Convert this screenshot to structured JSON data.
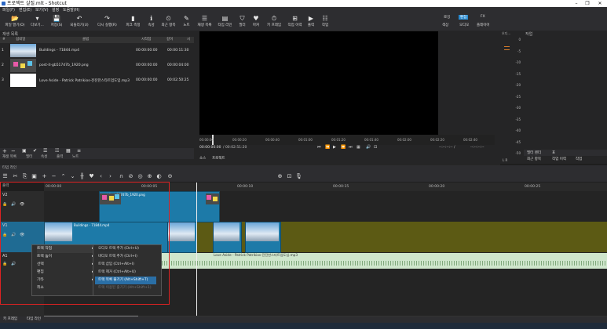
{
  "window": {
    "title": "프로젝트 살질.mlt - Shotcut"
  },
  "menus": [
    "파일(F)",
    "편집(E)",
    "보기(V)",
    "설정",
    "도움말(H)"
  ],
  "toolbar": [
    {
      "label": "파일 열기(O)",
      "icon": "folder-icon",
      "glyph": "📂"
    },
    {
      "label": "다보기...",
      "icon": "menu-icon",
      "glyph": "▾"
    },
    {
      "label": "저장(S)",
      "icon": "save-icon",
      "glyph": "💾"
    },
    {
      "label": "되돌리기(U)",
      "icon": "undo-icon",
      "glyph": "↶"
    },
    {
      "label": "다시 실행(R)",
      "icon": "redo-icon",
      "glyph": "↷"
    },
    {
      "label": "피크 측정",
      "icon": "peak-meter-icon",
      "glyph": "▮"
    },
    {
      "label": "속성",
      "icon": "properties-icon",
      "glyph": "ℹ"
    },
    {
      "label": "최근 항목",
      "icon": "recent-icon",
      "glyph": "⏲"
    },
    {
      "label": "노트",
      "icon": "notes-icon",
      "glyph": "✎"
    },
    {
      "label": "재생 목록",
      "icon": "playlist-icon",
      "glyph": "☰"
    },
    {
      "label": "타임 라인",
      "icon": "timeline-icon",
      "glyph": "▤"
    },
    {
      "label": "필터",
      "icon": "filter-icon",
      "glyph": "⛉"
    },
    {
      "label": "마커",
      "icon": "marker-icon",
      "glyph": "♥"
    },
    {
      "label": "키 프레임",
      "icon": "keyframe-icon",
      "glyph": "⏱"
    },
    {
      "label": "작업 이력",
      "icon": "history-icon",
      "glyph": "⊞"
    },
    {
      "label": "출력",
      "icon": "export-icon",
      "glyph": "▶"
    },
    {
      "label": "작업",
      "icon": "jobs-icon",
      "glyph": "☷"
    }
  ],
  "layout_tabs": {
    "top": [
      "로깅",
      "편집",
      "FX"
    ],
    "bottom": [
      "색상",
      "오디오",
      "플레이어"
    ],
    "active": "편집"
  },
  "playlist": {
    "title": "재생 목록",
    "columns": [
      "#",
      "섬네일",
      "클립",
      "시작점",
      "길이",
      "시"
    ],
    "rows": [
      {
        "index": "1",
        "name": "Buildings - 71844.mp4",
        "in": "00:00:00:00",
        "duration": "00:00:11:30",
        "thumb": "buildings"
      },
      {
        "index": "2",
        "name": "post-it-gb517d7b_1920.png",
        "in": "00:00:00:00",
        "duration": "00:00:04:00",
        "thumb": "postit"
      },
      {
        "index": "3",
        "name": "Love Aside - Patrick Patrikios-잔잔한스타트업도입.mp3",
        "in": "00:00:00:00",
        "duration": "00:02:50:25",
        "thumb": "white"
      }
    ],
    "bottom_tabs": [
      "재생 목록",
      "필터",
      "속성",
      "출력",
      "노트"
    ]
  },
  "player": {
    "ruler_ticks": [
      "00:00:00",
      "00:00:20",
      "00:00:40",
      "00:01:00",
      "00:01:20",
      "00:01:40",
      "00:02:00",
      "00:02:20",
      "00:02:40"
    ],
    "current_time": "00:00:00:00",
    "total_time": "/ 00:02:51:20",
    "in_out": "--:--:--:-- /",
    "out_time": "--:--:--:--",
    "tabs": [
      "소스",
      "프로젝트"
    ]
  },
  "meter": {
    "title": "오디...",
    "scale": [
      "0",
      "-5",
      "-10",
      "-15",
      "-20",
      "-25",
      "-30",
      "-35",
      "-40",
      "-45",
      "-50"
    ],
    "lr": "L R"
  },
  "right_panel": {
    "title": "작업",
    "tabs_top": [
      "필터 렌더",
      "표"
    ],
    "tabs_bottom": [
      "최근 항목",
      "작업 이력",
      "작업"
    ]
  },
  "timeline": {
    "title": "타임 라인",
    "ruler_label": "출력",
    "ticks": [
      "00:00:00",
      "00:00:05",
      "00:00:10",
      "00:00:15",
      "00:00:20",
      "00:00:25"
    ],
    "tracks": [
      {
        "name": "V2",
        "type": "video"
      },
      {
        "name": "V1",
        "type": "video"
      },
      {
        "name": "A1",
        "type": "audio"
      }
    ],
    "audio_clip_name": "Love Aside - Patrick Patrikios-잔잔한스타트업도입.mp3",
    "video_clip_name": "Buildings - 71844.mp4",
    "image_clip_name": "post-it-gb517d7b_1920.png"
  },
  "context_menu": {
    "items": [
      "트랙 작업",
      "트랙 높이",
      "선택",
      "편집",
      "기타",
      "취소"
    ],
    "submenu": [
      "오디오 트랙 추가 (Ctrl+U)",
      "비디오 트랙 추가 (Ctrl+I)",
      "트랙 삽입 (Ctrl+Alt+I)",
      "트랙 제거 (Ctrl+Alt+U)",
      "트랙 목록 줄기기 (Alt+Shift+T)",
      "트랙 이용된 줄기기 (Alt+Shift+1)"
    ]
  },
  "bottom_tabs": [
    "키 프레임",
    "타임 라인"
  ],
  "colors": {
    "accent": "#2a8bd0",
    "clip_blue": "#1d7aa8",
    "track_olive": "#5c5a14",
    "audio_green": "#cfe6cc",
    "highlight_box": "#dd2222"
  }
}
